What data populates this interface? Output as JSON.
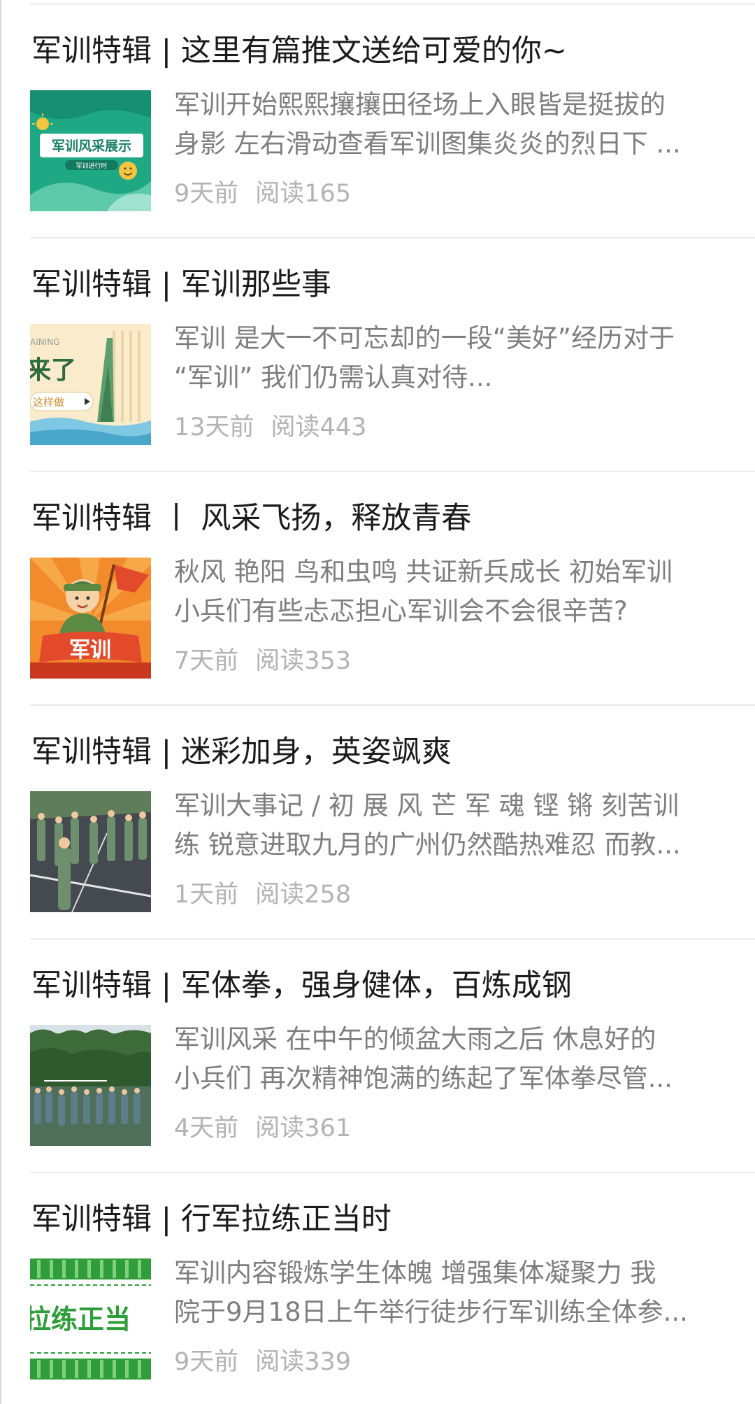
{
  "articles": [
    {
      "title": "军训特辑 | 这里有篇推文送给可爱的你~",
      "summary_lines": [
        "军训开始熙熙攘攘田径场上入眼皆是挺拔的",
        "身影 左右滑动查看军训图集炎炎的烈日下 ..."
      ],
      "time": "9天前",
      "reads": "阅读165",
      "thumb_text": [
        "军训风采展示",
        "军训进行时"
      ],
      "thumb_colors": {
        "bg": "#1fa884",
        "accent": "#f5c542"
      }
    },
    {
      "title": "军训特辑 | 军训那些事",
      "summary_lines": [
        "军训 是大一不可忘却的一段“美好”经历对于",
        "“军训” 我们仍需认真对待..."
      ],
      "time": "13天前",
      "reads": "阅读443",
      "thumb_text": [
        "AINING",
        "来了",
        "这样做"
      ],
      "thumb_colors": {
        "bg": "#fbf0d8",
        "accent": "#2e8b57"
      }
    },
    {
      "title": "军训特辑 丨 风采飞扬，释放青春",
      "summary_lines": [
        "秋风 艳阳 鸟和虫鸣 共证新兵成长 初始军训",
        "小兵们有些忐忑担心军训会不会很辛苦?"
      ],
      "time": "7天前",
      "reads": "阅读353",
      "thumb_text": [
        "军训"
      ],
      "thumb_colors": {
        "bg": "#f28b2c",
        "accent": "#e24a2b"
      }
    },
    {
      "title": "军训特辑 | 迷彩加身，英姿飒爽",
      "summary_lines": [
        "军训大事记 / 初 展 风 芒 军 魂 铿 锵 刻苦训",
        "练 锐意进取九月的广州仍然酷热难忍 而教..."
      ],
      "time": "1天前",
      "reads": "阅读258",
      "thumb_text": [],
      "thumb_colors": {
        "bg": "#3f4449",
        "accent": "#6b8f71"
      }
    },
    {
      "title": "军训特辑 | 军体拳，强身健体，百炼成钢",
      "summary_lines": [
        "军训风采 在中午的倾盆大雨之后 休息好的",
        "小兵们 再次精神饱满的练起了军体拳尽管..."
      ],
      "time": "4天前",
      "reads": "阅读361",
      "thumb_text": [],
      "thumb_colors": {
        "bg": "#3d6b3a",
        "accent": "#5f7d88"
      }
    },
    {
      "title": "军训特辑 | 行军拉练正当时",
      "summary_lines": [
        "军训内容锻炼学生体魄 增强集体凝聚力 我",
        "院于9月18日上午举行徒步行军训练全体参..."
      ],
      "time": "9天前",
      "reads": "阅读339",
      "thumb_text": [
        "拉练正当"
      ],
      "thumb_colors": {
        "bg": "#ffffff",
        "accent": "#2f9e3a"
      }
    }
  ]
}
